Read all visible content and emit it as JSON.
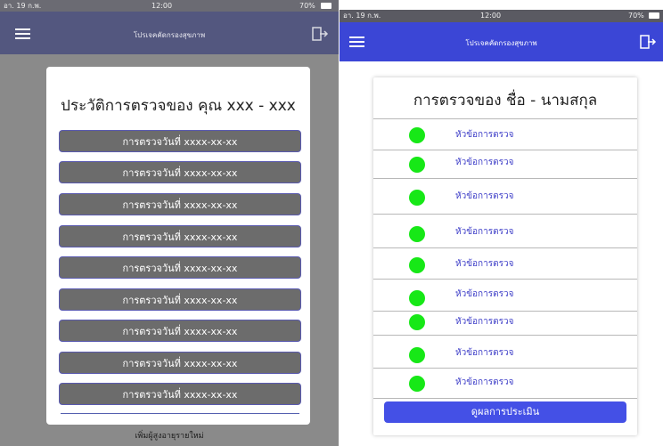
{
  "left_screen": {
    "status": {
      "carrier": "อา. 19 ก.พ.",
      "time": "12:00",
      "battery": "70%"
    },
    "nav": {
      "title": "โปรเจคคัดกรองสุขภาพ"
    },
    "title": "ประวัติการตรวจของ คุณ xxx - xxx",
    "records": [
      "การตรวจวันที่ xxxx-xx-xx",
      "การตรวจวันที่ xxxx-xx-xx",
      "การตรวจวันที่ xxxx-xx-xx",
      "การตรวจวันที่ xxxx-xx-xx",
      "การตรวจวันที่ xxxx-xx-xx",
      "การตรวจวันที่ xxxx-xx-xx",
      "การตรวจวันที่ xxxx-xx-xx",
      "การตรวจวันที่ xxxx-xx-xx",
      "การตรวจวันที่ xxxx-xx-xx"
    ],
    "footer_link": "เพิ่มผู้สูงอายุรายใหม่"
  },
  "right_screen": {
    "status": {
      "carrier": "อา. 19 ก.พ.",
      "time": "12:00",
      "battery": "70%"
    },
    "nav": {
      "title": "โปรเจคคัดกรองสุขภาพ"
    },
    "title": "การตรวจของ ชื่อ - นามสกุล",
    "exam_items": [
      "หัวข้อการตรวจ",
      "หัวข้อการตรวจ",
      "หัวข้อการตรวจ",
      "หัวข้อการตรวจ",
      "หัวข้อการตรวจ",
      "หัวข้อการตรวจ",
      "หัวข้อการตรวจ",
      "หัวข้อการตรวจ",
      "หัวข้อการตรวจ"
    ],
    "eval_button": "ดูผลการประเมิน"
  },
  "colors": {
    "left_nav": "#53577f",
    "right_nav": "#3b46d6",
    "record_button": "#6c6c6c",
    "status_dot": "#17e817",
    "item_label": "#3f3fc8",
    "eval_button": "#4450e6"
  },
  "icons": [
    "hamburger-menu-icon",
    "exit-door-icon",
    "battery-icon",
    "status-dot"
  ]
}
